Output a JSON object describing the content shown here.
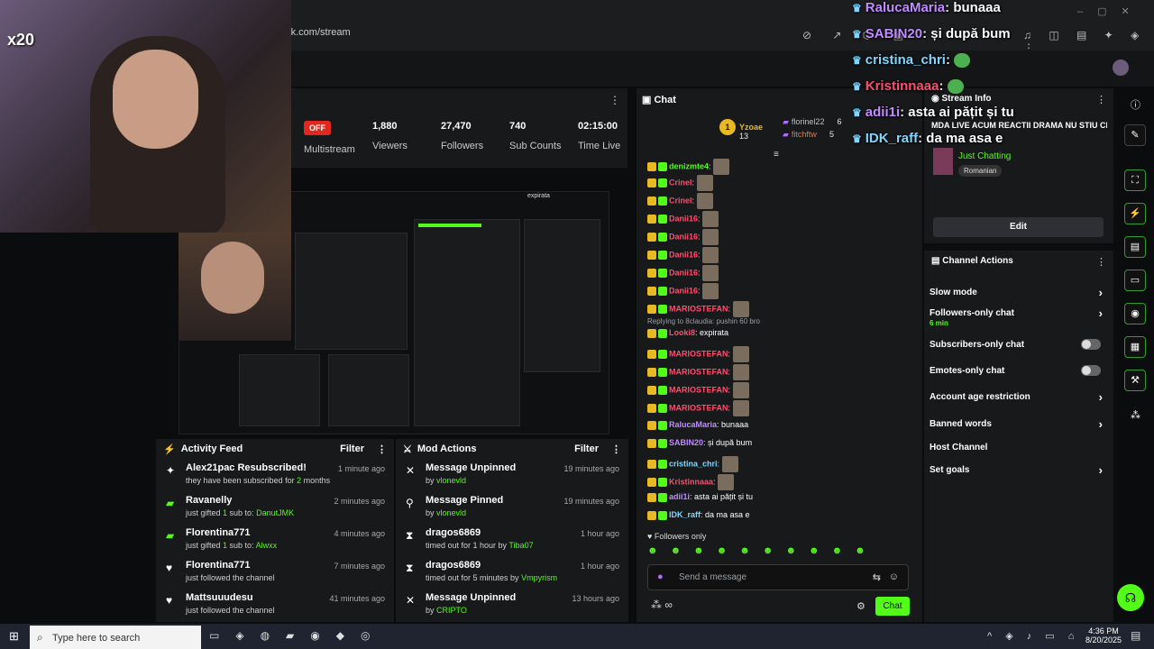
{
  "browser": {
    "url": "d.kick.com/stream"
  },
  "webcam": {
    "overlay_text": "x20"
  },
  "stats": {
    "status_badge": "OFF",
    "multistream_label": "Multistream",
    "viewers_value": "1,880",
    "viewers_label": "Viewers",
    "followers_value": "27,470",
    "followers_label": "Followers",
    "subs_value": "740",
    "subs_label": "Sub Counts",
    "time_value": "02:15:00",
    "time_label": "Time Live"
  },
  "preview": {
    "mini_chat_line": "expirata"
  },
  "activity_feed": {
    "title": "Activity Feed",
    "filter_label": "Filter",
    "items": [
      {
        "title": "Alex21pac Resubscribed!",
        "line2_prefix": "they have been subscribed for ",
        "line2_highlight": "2",
        "line2_suffix": " months",
        "time": "1 minute ago",
        "icon": "sparkle-icon"
      },
      {
        "title": "Ravanelly",
        "line2_prefix": "just gifted ",
        "line2_highlight": "1",
        "line2_suffix": " sub to: ",
        "line2_user": "DanutJMK",
        "time": "2 minutes ago",
        "icon": "gift-icon"
      },
      {
        "title": "Florentina771",
        "line2_prefix": "just gifted ",
        "line2_highlight": "1",
        "line2_suffix": " sub to: ",
        "line2_user": "Alwxx",
        "time": "4 minutes ago",
        "icon": "gift-icon"
      },
      {
        "title": "Florentina771",
        "line2_prefix": "just followed the channel",
        "line2_highlight": "",
        "line2_suffix": "",
        "time": "7 minutes ago",
        "icon": "heart-icon"
      },
      {
        "title": "Mattsuuudesu",
        "line2_prefix": "just followed the channel",
        "line2_highlight": "",
        "line2_suffix": "",
        "time": "41 minutes ago",
        "icon": "heart-icon"
      }
    ]
  },
  "mod_actions": {
    "title": "Mod Actions",
    "filter_label": "Filter",
    "items": [
      {
        "title": "Message Unpinned",
        "line2_prefix": "by ",
        "line2_user": "vlonevld",
        "time": "19 minutes ago",
        "icon": "unpin-icon"
      },
      {
        "title": "Message Pinned",
        "line2_prefix": "by ",
        "line2_user": "vlonevld",
        "time": "19 minutes ago",
        "icon": "pin-icon"
      },
      {
        "title": "dragos6869",
        "line2_prefix": "timed out for 1 hour by ",
        "line2_user": "Tiba07",
        "time": "1 hour ago",
        "icon": "hourglass-icon"
      },
      {
        "title": "dragos6869",
        "line2_prefix": "timed out for 5 minutes by ",
        "line2_user": "Vmpyrism",
        "time": "1 hour ago",
        "icon": "hourglass-icon"
      },
      {
        "title": "Message Unpinned",
        "line2_prefix": "by ",
        "line2_user": "CRIPTO",
        "time": "13 hours ago",
        "icon": "unpin-icon"
      }
    ]
  },
  "chat": {
    "title": "Chat",
    "top_gifters": [
      {
        "name": "Yzoae",
        "count": "13"
      },
      {
        "name": "florinel22",
        "count": "6"
      },
      {
        "name": "fitchftw",
        "count": "5"
      }
    ],
    "messages": [
      {
        "user": "denizmte4",
        "user_color": "#53fc18",
        "text": ""
      },
      {
        "user": "Crinel",
        "user_color": "#ff4d6d",
        "text": ""
      },
      {
        "user": "Crinel",
        "user_color": "#ff4d6d",
        "text": ""
      },
      {
        "user": "Danii16",
        "user_color": "#ff4d6d",
        "text": ""
      },
      {
        "user": "Danii16",
        "user_color": "#ff4d6d",
        "text": ""
      },
      {
        "user": "Danii16",
        "user_color": "#ff4d6d",
        "text": ""
      },
      {
        "user": "Danii16",
        "user_color": "#ff4d6d",
        "text": ""
      },
      {
        "user": "Danii16",
        "user_color": "#ff4d6d",
        "text": ""
      },
      {
        "user": "MARIOSTEFAN",
        "user_color": "#ff4d6d",
        "text": ""
      },
      {
        "user": "Looki8",
        "user_color": "#ff4d6d",
        "text": "expirata"
      },
      {
        "user": "MARIOSTEFAN",
        "user_color": "#ff4d6d",
        "text": ""
      },
      {
        "user": "MARIOSTEFAN",
        "user_color": "#ff4d6d",
        "text": ""
      },
      {
        "user": "MARIOSTEFAN",
        "user_color": "#ff4d6d",
        "text": ""
      },
      {
        "user": "MARIOSTEFAN",
        "user_color": "#ff4d6d",
        "text": ""
      },
      {
        "user": "RalucaMaria",
        "user_color": "#c08cff",
        "text": "bunaaa"
      },
      {
        "user": "SABIN20",
        "user_color": "#c08cff",
        "text": "și după bum"
      },
      {
        "user": "cristina_chri",
        "user_color": "#7fd7ff",
        "text": ""
      },
      {
        "user": "Kristinnaaa",
        "user_color": "#ff4d6d",
        "text": ""
      },
      {
        "user": "adii1i",
        "user_color": "#c08cff",
        "text": "asta ai pățit și tu"
      },
      {
        "user": "IDK_raff",
        "user_color": "#7fd7ff",
        "text": "da ma asa e"
      }
    ],
    "reply_context": "Replying to 8claudia: pushin 60 bro",
    "followers_only": "Followers only",
    "input_placeholder": "Send a message",
    "send_label": "Chat"
  },
  "stream_info": {
    "title": "Stream Info",
    "stream_title": "MDA LIVE ACUM REACTII DRAMA NU STIU CE...",
    "category": "Just Chatting",
    "language": "Romanian",
    "edit_label": "Edit"
  },
  "channel_actions": {
    "title": "Channel Actions",
    "items": [
      {
        "label": "Slow mode",
        "type": "chevron",
        "sub": ""
      },
      {
        "label": "Followers-only chat",
        "type": "chevron",
        "sub": "6 min"
      },
      {
        "label": "Subscribers-only chat",
        "type": "toggle",
        "sub": ""
      },
      {
        "label": "Emotes-only chat",
        "type": "toggle",
        "sub": ""
      },
      {
        "label": "Account age restriction",
        "type": "chevron",
        "sub": ""
      },
      {
        "label": "Banned words",
        "type": "chevron",
        "sub": ""
      },
      {
        "label": "Host Channel",
        "type": "none",
        "sub": ""
      },
      {
        "label": "Set goals",
        "type": "chevron",
        "sub": ""
      }
    ]
  },
  "overlay_chat": [
    {
      "user": "RalucaMaria",
      "user_color": "#c08cff",
      "text": "bunaaa"
    },
    {
      "user": "SABIN20",
      "user_color": "#c08cff",
      "text": "și după bum"
    },
    {
      "user": "cristina_chri",
      "user_color": "#7fd7ff",
      "text": ""
    },
    {
      "user": "Kristinnaaa",
      "user_color": "#ff4d6d",
      "text": ""
    },
    {
      "user": "adii1i",
      "user_color": "#c08cff",
      "text": "asta ai pățit și tu"
    },
    {
      "user": "IDK_raff",
      "user_color": "#7fd7ff",
      "text": "da ma asa e"
    }
  ],
  "taskbar": {
    "search_placeholder": "Type here to search",
    "time": "4:36 PM",
    "date": "8/20/2025"
  }
}
